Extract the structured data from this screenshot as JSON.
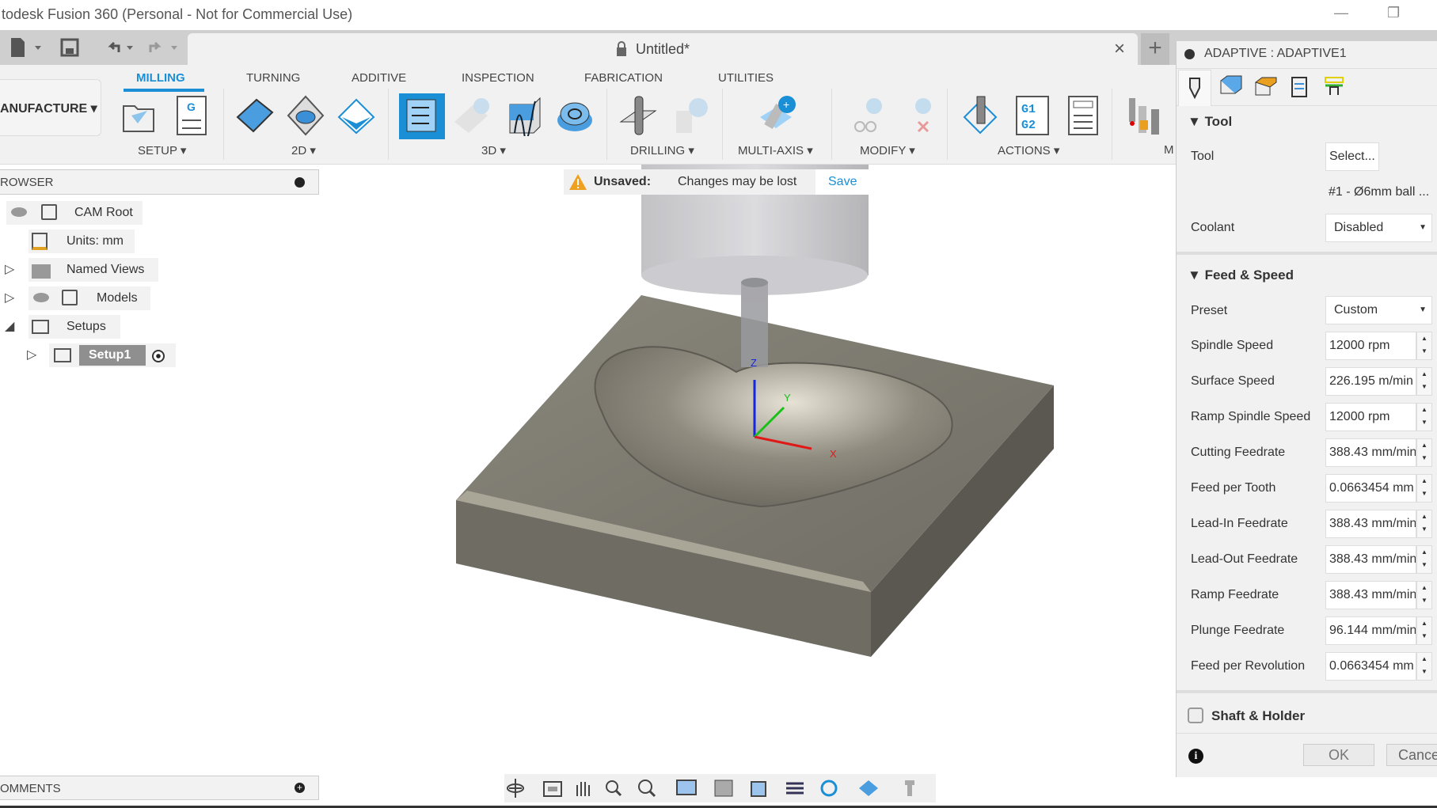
{
  "window": {
    "title": "todesk Fusion 360 (Personal - Not for Commercial Use)",
    "minimize": "—",
    "restore": "❐"
  },
  "document": {
    "title": "Untitled*",
    "close": "×",
    "new_tab": "+"
  },
  "workspace": {
    "label": "ANUFACTURE ▾"
  },
  "ribbon": {
    "tabs": [
      "MILLING",
      "TURNING",
      "ADDITIVE",
      "INSPECTION",
      "FABRICATION",
      "UTILITIES"
    ],
    "active": "MILLING",
    "groups": [
      "SETUP ▾",
      "2D ▾",
      "3D ▾",
      "DRILLING ▾",
      "MULTI-AXIS ▾",
      "MODIFY ▾",
      "ACTIONS ▾",
      "M"
    ]
  },
  "browser": {
    "title": "ROWSER",
    "items": [
      {
        "label": "CAM Root"
      },
      {
        "label": "Units: mm"
      },
      {
        "label": "Named Views"
      },
      {
        "label": "Models"
      },
      {
        "label": "Setups"
      },
      {
        "label": "Setup1"
      }
    ]
  },
  "notice": {
    "label": "Unsaved:",
    "message": "Changes may be lost",
    "action": "Save"
  },
  "comments": {
    "title": "OMMENTS"
  },
  "viewport": {
    "axes": {
      "x": "X",
      "y": "Y",
      "z": "Z"
    }
  },
  "panel": {
    "title": "ADAPTIVE : ADAPTIVE1",
    "tool_section": {
      "title": "Tool",
      "tool_label": "Tool",
      "tool_button": "Select...",
      "tool_name": "#1 - Ø6mm ball ...",
      "coolant_label": "Coolant",
      "coolant_value": "Disabled"
    },
    "feed_section": {
      "title": "Feed & Speed",
      "preset_label": "Preset",
      "preset_value": "Custom",
      "fields": [
        {
          "label": "Spindle Speed",
          "value": "12000 rpm"
        },
        {
          "label": "Surface Speed",
          "value": "226.195 m/min"
        },
        {
          "label": "Ramp Spindle Speed",
          "value": "12000 rpm"
        },
        {
          "label": "Cutting Feedrate",
          "value": "388.43 mm/min"
        },
        {
          "label": "Feed per Tooth",
          "value": "0.0663454 mm"
        },
        {
          "label": "Lead-In Feedrate",
          "value": "388.43 mm/min"
        },
        {
          "label": "Lead-Out Feedrate",
          "value": "388.43 mm/min"
        },
        {
          "label": "Ramp Feedrate",
          "value": "388.43 mm/min"
        },
        {
          "label": "Plunge Feedrate",
          "value": "96.144 mm/min"
        },
        {
          "label": "Feed per Revolution",
          "value": "0.0663454 mm"
        }
      ]
    },
    "shaft_section": {
      "title": "Shaft & Holder",
      "checked": false
    },
    "ok": "OK",
    "cancel": "Cance"
  },
  "colors": {
    "accent": "#1b8fd6",
    "stock": "#7c7a70"
  }
}
